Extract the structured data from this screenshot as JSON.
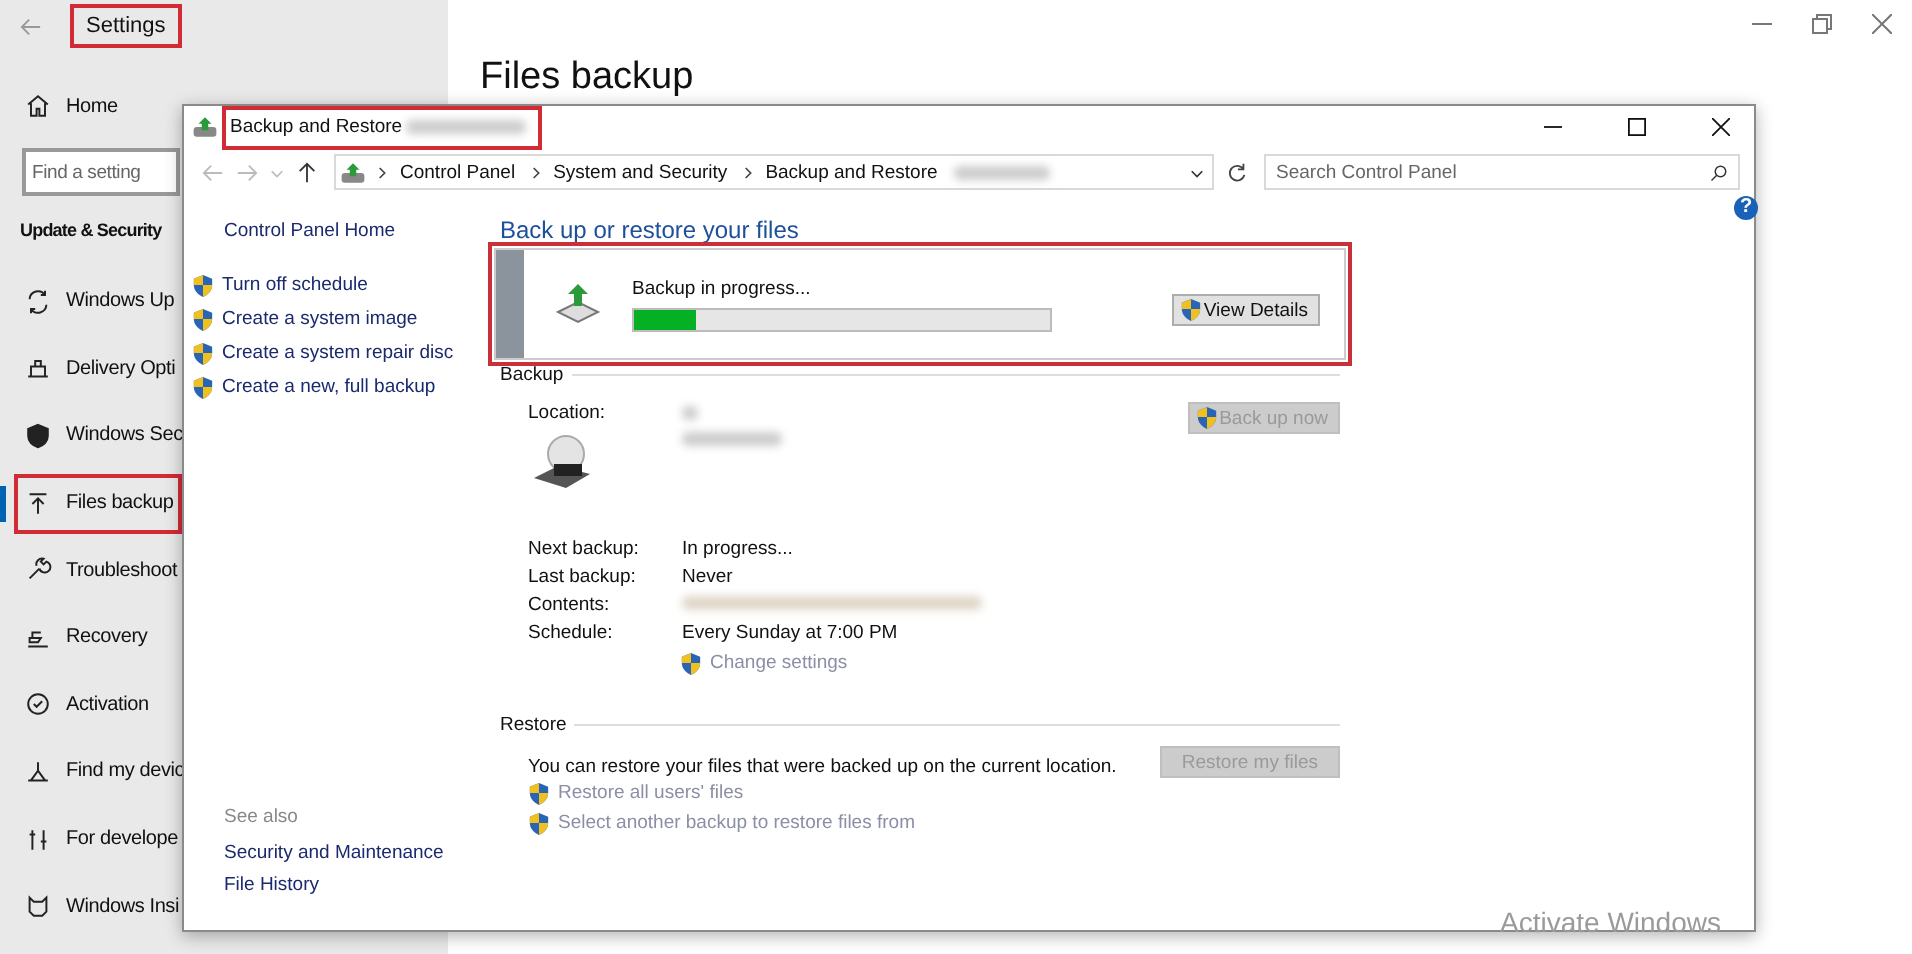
{
  "settings": {
    "title": "Settings",
    "title_highlighted": true,
    "home": "Home",
    "search": {
      "placeholder": "Find a setting"
    },
    "section": "Update & Security",
    "nav": [
      {
        "label": "Windows Up",
        "selected": false,
        "highlighted": false
      },
      {
        "label": "Delivery Opti",
        "selected": false,
        "highlighted": false
      },
      {
        "label": "Windows Sec",
        "selected": false,
        "highlighted": false
      },
      {
        "label": "Files backup",
        "selected": true,
        "highlighted": true
      },
      {
        "label": "Troubleshoot",
        "selected": false,
        "highlighted": false
      },
      {
        "label": "Recovery",
        "selected": false,
        "highlighted": false
      },
      {
        "label": "Activation",
        "selected": false,
        "highlighted": false
      },
      {
        "label": "Find my devic",
        "selected": false,
        "highlighted": false
      },
      {
        "label": "For develope",
        "selected": false,
        "highlighted": false
      },
      {
        "label": "Windows Insi",
        "selected": false,
        "highlighted": false
      }
    ],
    "page_title": "Files backup"
  },
  "dialog": {
    "title": "Backup and Restore",
    "title_highlighted": true,
    "breadcrumb": [
      "Control Panel",
      "System and Security",
      "Backup and Restore"
    ],
    "search": {
      "placeholder": "Search Control Panel"
    },
    "help": "?",
    "sidebar": {
      "home": "Control Panel Home",
      "tasks": [
        "Turn off schedule",
        "Create a system image",
        "Create a system repair disc",
        "Create a new, full backup"
      ],
      "see_also_title": "See also",
      "see_also": [
        "Security and Maintenance",
        "File History"
      ]
    },
    "heading": "Back up or restore your files",
    "progress": {
      "label": "Backup in progress...",
      "level": 0.15,
      "button": "View Details",
      "highlighted": true
    },
    "backup": {
      "title": "Backup",
      "location_label": "Location:",
      "back_up_button": {
        "label": "Back up now",
        "disabled": true
      },
      "rows": [
        {
          "label": "Next backup:",
          "value": "In progress..."
        },
        {
          "label": "Last backup:",
          "value": "Never"
        },
        {
          "label": "Contents:"
        },
        {
          "label": "Schedule:",
          "value": "Every Sunday at 7:00 PM"
        }
      ],
      "change_settings": {
        "label": "Change settings",
        "disabled": true
      }
    },
    "restore": {
      "title": "Restore",
      "text": "You can restore your files that were backed up on the current location.",
      "button": {
        "label": "Restore my files",
        "disabled": true
      },
      "links": [
        {
          "label": "Restore all users' files",
          "disabled": true
        },
        {
          "label": "Select another backup to restore files from",
          "disabled": true
        }
      ]
    }
  },
  "watermark": "Activate Windows"
}
